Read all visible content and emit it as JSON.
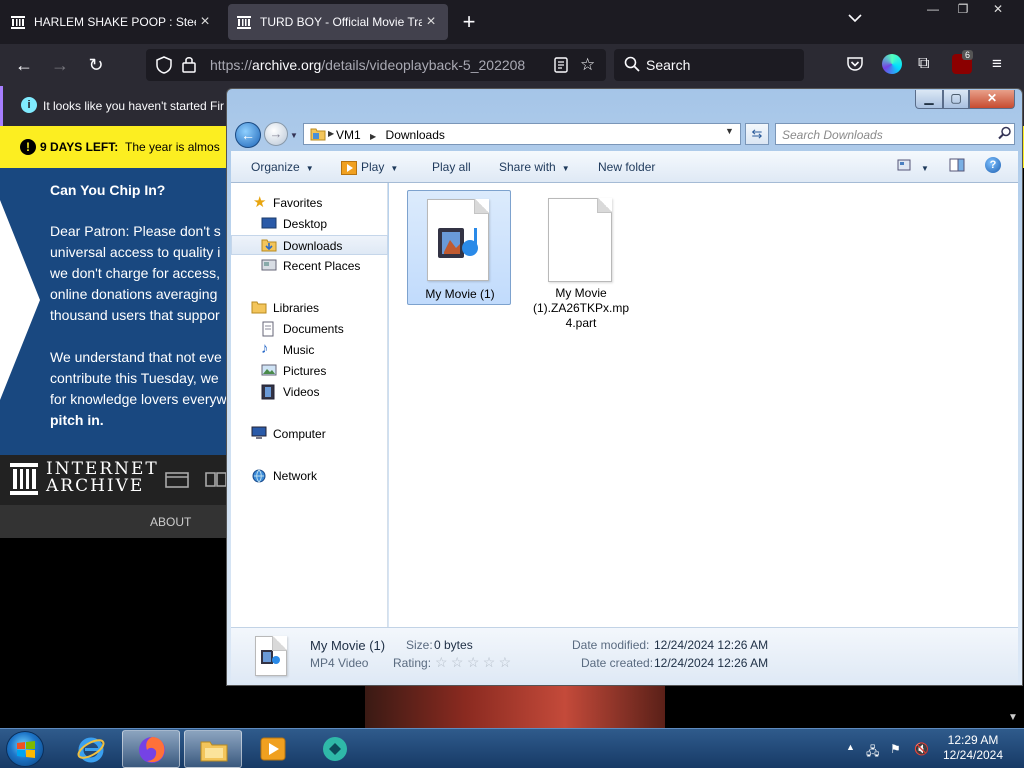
{
  "browser": {
    "tabs": [
      {
        "title": "HARLEM SHAKE POOP : Steezy",
        "active": false
      },
      {
        "title": "TURD BOY - Official Movie Trail",
        "active": true
      }
    ],
    "url_prefix": "https://",
    "url_domain": "archive.org",
    "url_path": "/details/videoplayback-5_202208",
    "search_placeholder": "Search",
    "extension_badge": "6"
  },
  "notification": {
    "text": "It looks like you haven't started Fir"
  },
  "page": {
    "banner_bold": "9 DAYS LEFT:",
    "banner_text": "The year is almos",
    "chip_title": "Can You Chip In?",
    "chip_lines": [
      "Dear Patron: Please don't s",
      "universal access to quality i",
      "we don't charge for access,",
      "online donations averaging",
      "thousand users that suppor",
      "",
      "We understand that not eve",
      "contribute this Tuesday, we",
      "for knowledge lovers everyw",
      "pitch in."
    ],
    "logo_line1": "INTERNET",
    "logo_line2": "ARCHIVE",
    "about": "ABOUT"
  },
  "explorer": {
    "breadcrumb": [
      "VM1",
      "Downloads"
    ],
    "search_placeholder": "Search Downloads",
    "commands": {
      "organize": "Organize",
      "play": "Play",
      "play_all": "Play all",
      "share_with": "Share with",
      "new_folder": "New folder"
    },
    "nav": {
      "favorites": "Favorites",
      "desktop": "Desktop",
      "downloads": "Downloads",
      "recent_places": "Recent Places",
      "libraries": "Libraries",
      "documents": "Documents",
      "music": "Music",
      "pictures": "Pictures",
      "videos": "Videos",
      "computer": "Computer",
      "network": "Network"
    },
    "files": [
      {
        "name": "My Movie (1)",
        "selected": true
      },
      {
        "name_lines": [
          "My Movie",
          "(1).ZA26TKPx.mp",
          "4.part"
        ],
        "selected": false
      }
    ],
    "details": {
      "name": "My Movie (1)",
      "type": "MP4 Video",
      "size_label": "Size:",
      "size_value": "0 bytes",
      "rating_label": "Rating:",
      "rating_stars": 0,
      "modified_label": "Date modified:",
      "modified_value": "12/24/2024 12:26 AM",
      "created_label": "Date created:",
      "created_value": "12/24/2024 12:26 AM"
    }
  },
  "taskbar": {
    "time": "12:29 AM",
    "date": "12/24/2024"
  }
}
